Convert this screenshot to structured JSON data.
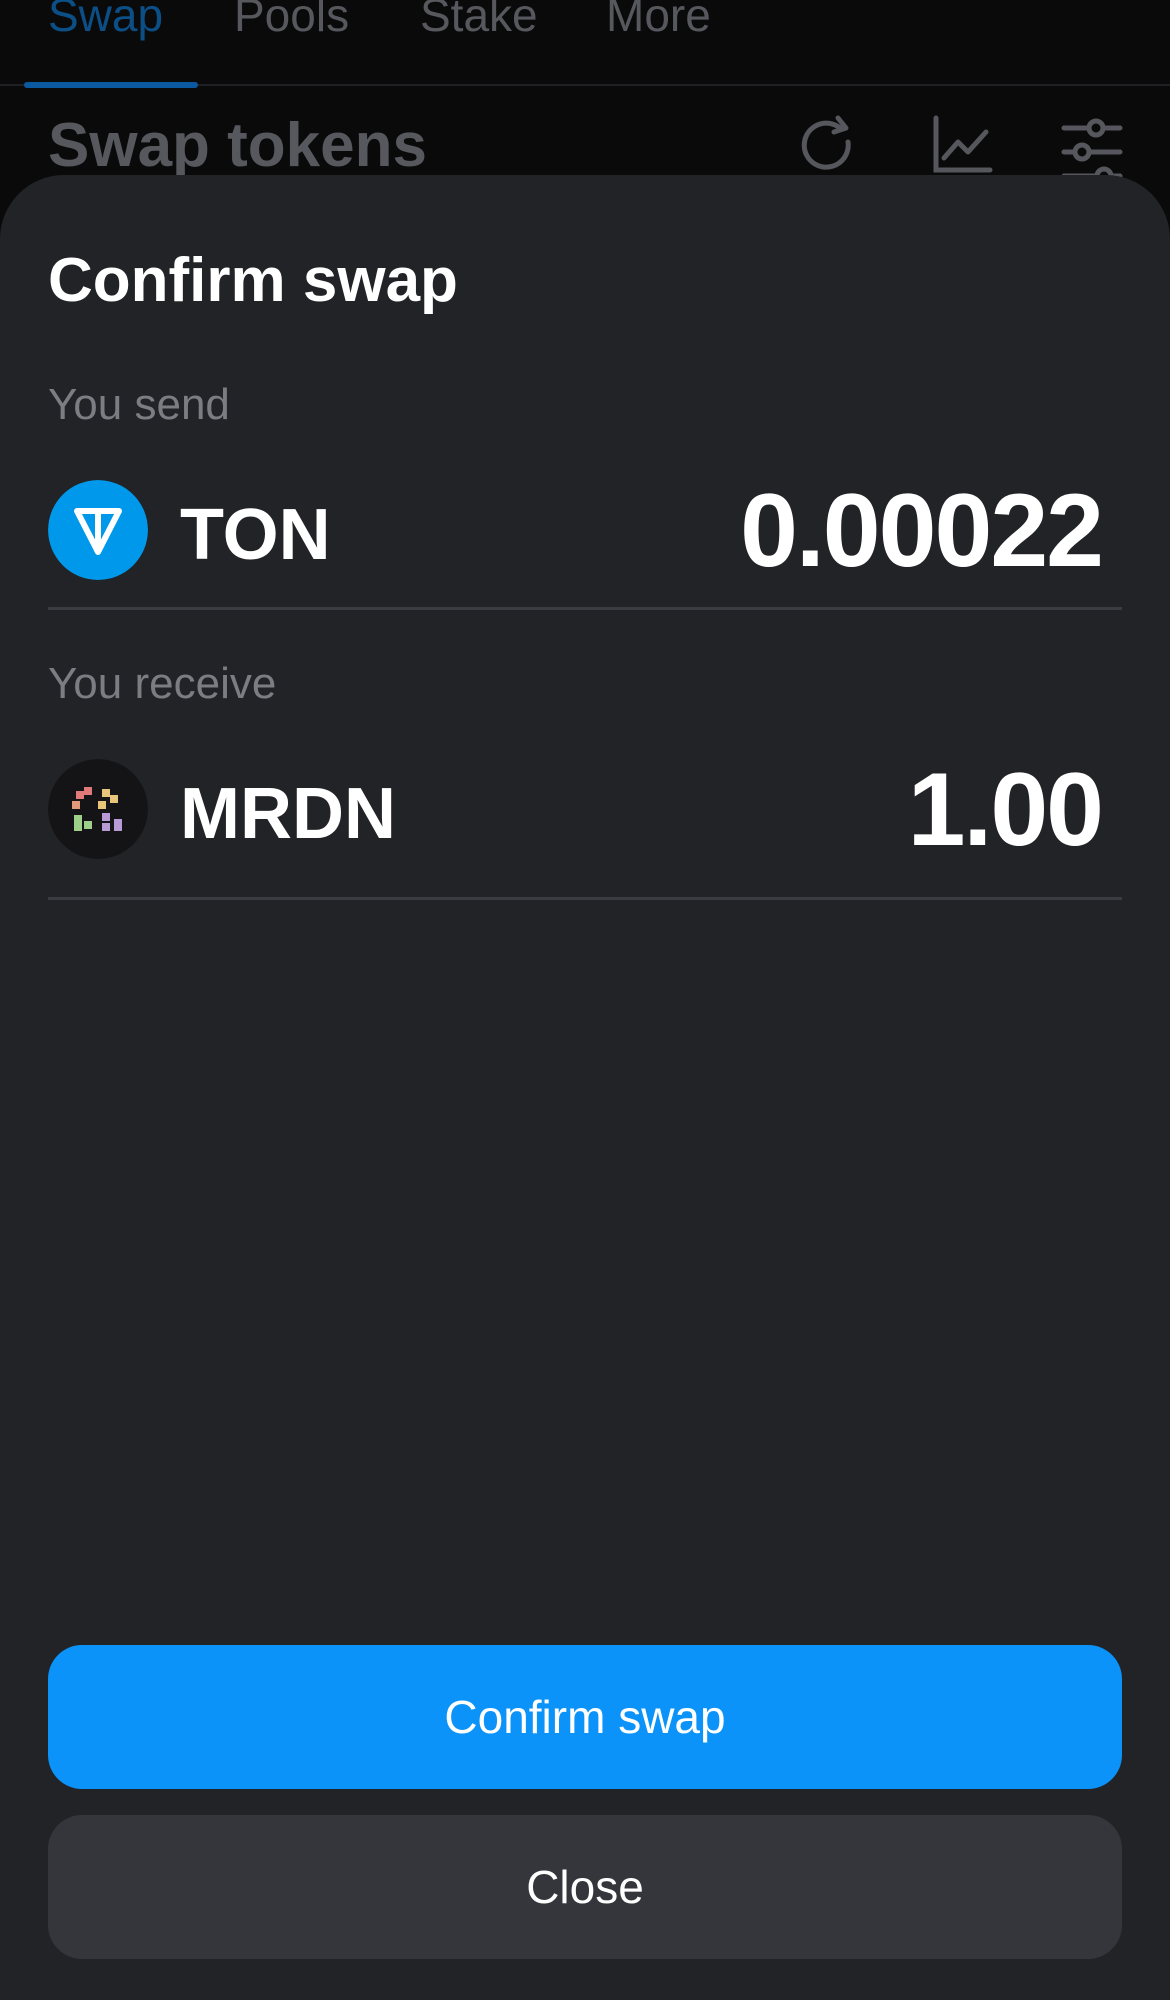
{
  "tabs": [
    {
      "label": "Swap",
      "active": true
    },
    {
      "label": "Pools",
      "active": false
    },
    {
      "label": "Stake",
      "active": false
    },
    {
      "label": "More",
      "active": false
    }
  ],
  "header": {
    "title": "Swap tokens",
    "icons": [
      "refresh-icon",
      "chart-icon",
      "settings-sliders-icon"
    ]
  },
  "sheet": {
    "title": "Confirm swap",
    "send": {
      "caption": "You send",
      "token": "TON",
      "amount": "0.00022",
      "icon": "ton-logo-icon"
    },
    "receive": {
      "caption": "You receive",
      "token": "MRDN",
      "amount": "1.00",
      "icon": "mrdn-logo-icon"
    },
    "confirm_label": "Confirm swap",
    "close_label": "Close"
  },
  "colors": {
    "accent": "#0b93f9",
    "sheet_bg": "#222327",
    "ton_blue": "#0098ea"
  }
}
